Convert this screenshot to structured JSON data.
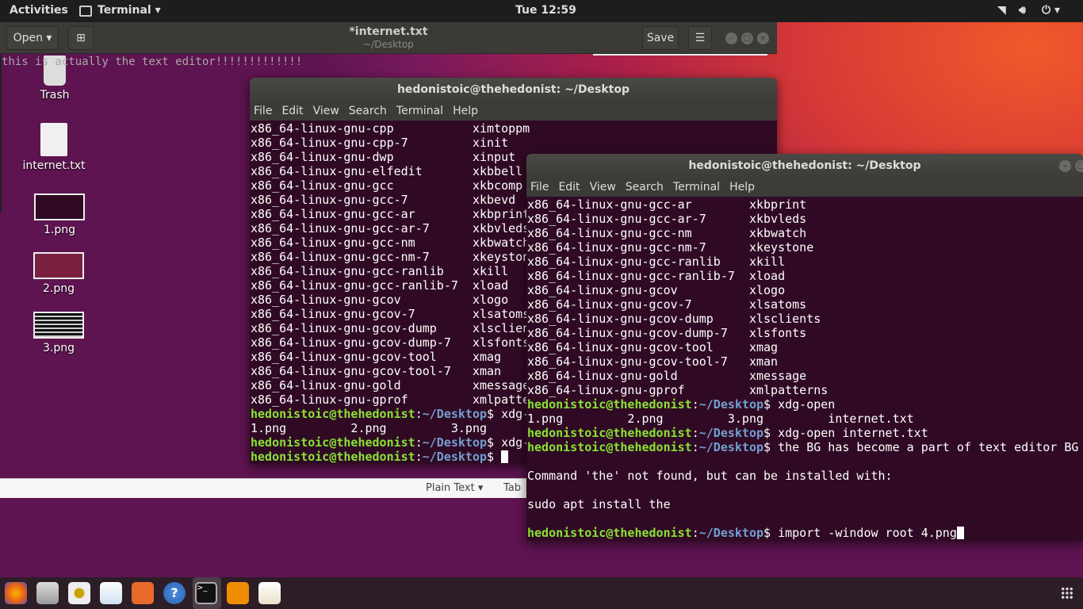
{
  "topbar": {
    "activities": "Activities",
    "app_menu": "Terminal ▾",
    "clock": "Tue 12:59",
    "status_icons": [
      "network-icon",
      "volume-icon",
      "power-icon"
    ]
  },
  "gedit": {
    "open_label": "Open ▾",
    "title": "*internet.txt",
    "subtitle": "~/Desktop",
    "save_label": "Save",
    "menu_icon": "☰",
    "content": "this is actually the text editor!!!!!!!!!!!!!",
    "status_language": "Plain Text ▾",
    "status_tab": "Tab"
  },
  "desktop": {
    "icons": [
      {
        "label": "Trash",
        "icon": "trash-icon"
      },
      {
        "label": "internet.txt",
        "icon": "text-file-icon"
      },
      {
        "label": "1.png"
      },
      {
        "label": "2.png"
      },
      {
        "label": "3.png"
      }
    ]
  },
  "terminal_menu": [
    "File",
    "Edit",
    "View",
    "Search",
    "Terminal",
    "Help"
  ],
  "prompt": {
    "user": "hedonistoic@thehedonist",
    "path": "~/Desktop"
  },
  "terminal1": {
    "title": "hedonistoic@thehedonist: ~/Desktop",
    "lines": [
      {
        "t": "x86_64-linux-gnu-cpp           ximtoppm"
      },
      {
        "t": "x86_64-linux-gnu-cpp-7         xinit"
      },
      {
        "t": "x86_64-linux-gnu-dwp           xinput"
      },
      {
        "t": "x86_64-linux-gnu-elfedit       xkbbell"
      },
      {
        "t": "x86_64-linux-gnu-gcc           xkbcomp"
      },
      {
        "t": "x86_64-linux-gnu-gcc-7         xkbevd"
      },
      {
        "t": "x86_64-linux-gnu-gcc-ar        xkbprint"
      },
      {
        "t": "x86_64-linux-gnu-gcc-ar-7      xkbvleds"
      },
      {
        "t": "x86_64-linux-gnu-gcc-nm        xkbwatch"
      },
      {
        "t": "x86_64-linux-gnu-gcc-nm-7      xkeystone"
      },
      {
        "t": "x86_64-linux-gnu-gcc-ranlib    xkill"
      },
      {
        "t": "x86_64-linux-gnu-gcc-ranlib-7  xload"
      },
      {
        "t": "x86_64-linux-gnu-gcov          xlogo"
      },
      {
        "t": "x86_64-linux-gnu-gcov-7        xlsatoms"
      },
      {
        "t": "x86_64-linux-gnu-gcov-dump     xlsclients"
      },
      {
        "t": "x86_64-linux-gnu-gcov-dump-7   xlsfonts"
      },
      {
        "t": "x86_64-linux-gnu-gcov-tool     xmag"
      },
      {
        "t": "x86_64-linux-gnu-gcov-tool-7   xman"
      },
      {
        "t": "x86_64-linux-gnu-gold          xmessage"
      },
      {
        "t": "x86_64-linux-gnu-gprof         xmlpatterns"
      },
      {
        "cmd": "xdg-open"
      },
      {
        "t": "1.png         2.png         3.png"
      },
      {
        "cmd": "xdg-open internet.txt"
      },
      {
        "cmd": "",
        "cursor": true
      }
    ]
  },
  "terminal2": {
    "title": "hedonistoic@thehedonist: ~/Desktop",
    "lines": [
      {
        "t": "x86_64-linux-gnu-gcc-ar        xkbprint"
      },
      {
        "t": "x86_64-linux-gnu-gcc-ar-7      xkbvleds"
      },
      {
        "t": "x86_64-linux-gnu-gcc-nm        xkbwatch"
      },
      {
        "t": "x86_64-linux-gnu-gcc-nm-7      xkeystone"
      },
      {
        "t": "x86_64-linux-gnu-gcc-ranlib    xkill"
      },
      {
        "t": "x86_64-linux-gnu-gcc-ranlib-7  xload"
      },
      {
        "t": "x86_64-linux-gnu-gcov          xlogo"
      },
      {
        "t": "x86_64-linux-gnu-gcov-7        xlsatoms"
      },
      {
        "t": "x86_64-linux-gnu-gcov-dump     xlsclients"
      },
      {
        "t": "x86_64-linux-gnu-gcov-dump-7   xlsfonts"
      },
      {
        "t": "x86_64-linux-gnu-gcov-tool     xmag"
      },
      {
        "t": "x86_64-linux-gnu-gcov-tool-7   xman"
      },
      {
        "t": "x86_64-linux-gnu-gold          xmessage"
      },
      {
        "t": "x86_64-linux-gnu-gprof         xmlpatterns"
      },
      {
        "cmd": "xdg-open"
      },
      {
        "t": "1.png         2.png         3.png         internet.txt"
      },
      {
        "cmd": "xdg-open internet.txt"
      },
      {
        "cmd": "the BG has become a part of text editor BG"
      },
      {
        "t": ""
      },
      {
        "t": "Command 'the' not found, but can be installed with:"
      },
      {
        "t": ""
      },
      {
        "t": "sudo apt install the"
      },
      {
        "t": ""
      },
      {
        "cmd": "import -window root 4.png",
        "cursor": true
      }
    ]
  },
  "dock": {
    "apps": [
      "firefox-icon",
      "files-icon",
      "rhythmbox-icon",
      "libreoffice-impress-icon",
      "software-center-icon",
      "help-icon",
      "terminal-icon",
      "vlc-icon",
      "text-editor-icon"
    ],
    "active": "terminal-icon",
    "show_apps": "show-apps-icon"
  }
}
